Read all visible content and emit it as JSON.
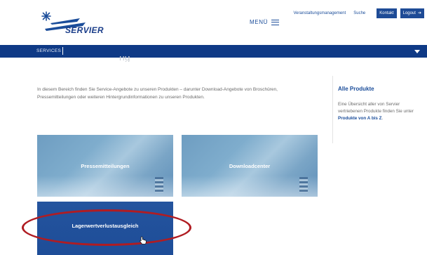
{
  "header": {
    "brand": "SERVIER",
    "menu_label": "MENÜ",
    "top_links": [
      "Veranstaltungsmanagement",
      "Suche"
    ],
    "buttons": {
      "kontakt": "Kontakt",
      "logout": "Logout"
    }
  },
  "nav": {
    "label": "SERVICES"
  },
  "intro": {
    "text": "In diesem Bereich finden Sie Service-Angebote zu unseren Produkten – darunter Download-Angebote von Broschüren, Pressemitteilungen oder weiteren Hintergrundinformationen zu unseren Produkten."
  },
  "aside": {
    "title": "Alle Produkte",
    "text_before": "Eine Übersicht aller von Servier vertriebenen Produkte finden Sie unter",
    "link": "Produkte von A bis Z",
    "text_after": "."
  },
  "tiles": [
    {
      "label": "Pressemitteilungen"
    },
    {
      "label": "Downloadcenter"
    },
    {
      "label": "Lagerwertverlustausgleich"
    }
  ],
  "colors": {
    "brand": "#1b4d9a",
    "navbar": "#0f3a86",
    "highlight": "#b01c22"
  }
}
